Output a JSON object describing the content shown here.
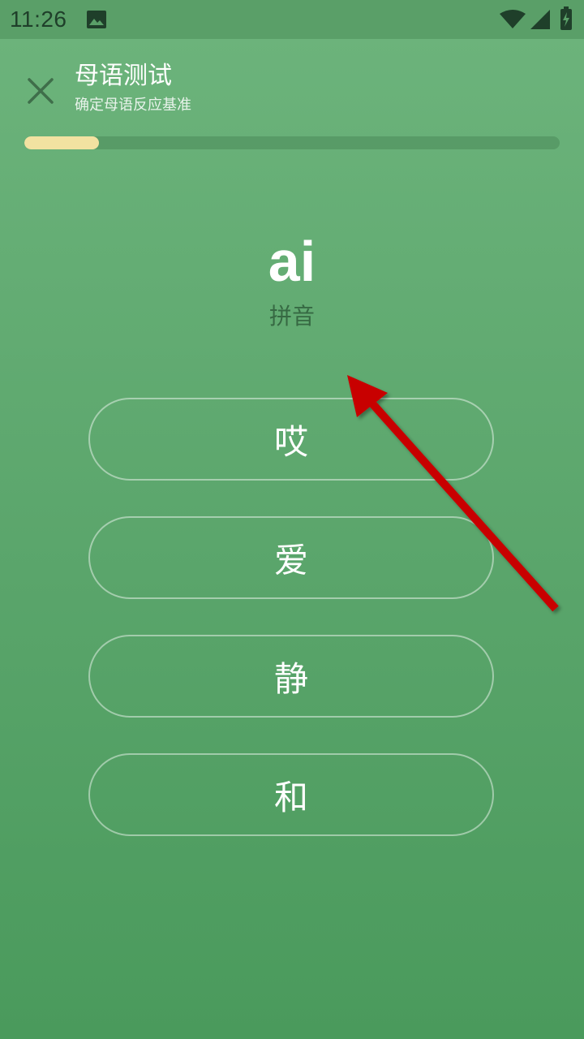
{
  "status_bar": {
    "time": "11:26",
    "icons": [
      "image-icon",
      "wifi-icon",
      "signal-icon",
      "battery-charging-icon"
    ]
  },
  "header": {
    "title": "母语测试",
    "subtitle": "确定母语反应基准",
    "close_icon": "close-icon"
  },
  "progress": {
    "fraction": 0.14,
    "fill_color": "#f2e2a1",
    "track_color": "#5f9f6d"
  },
  "question": {
    "text": "ai",
    "hint": "拼音"
  },
  "options": [
    {
      "label": "哎"
    },
    {
      "label": "爱"
    },
    {
      "label": "静"
    },
    {
      "label": "和"
    }
  ],
  "colors": {
    "background_top": "#6db47c",
    "background_bottom": "#4a9a5c",
    "status_bar": "#5a9f68",
    "annotation_arrow": "#c80000"
  }
}
